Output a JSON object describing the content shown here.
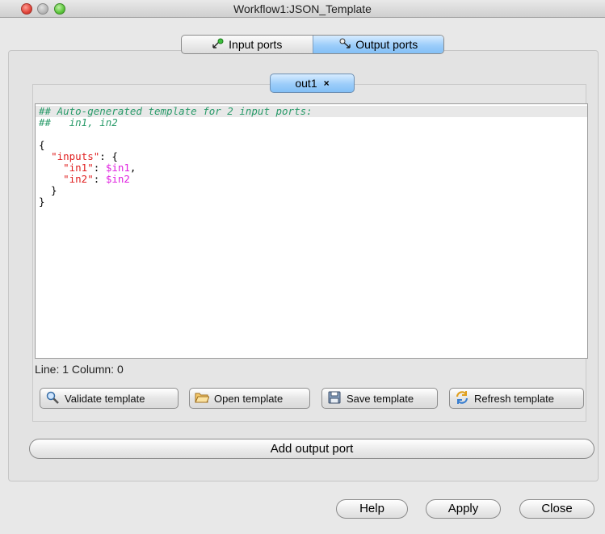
{
  "window": {
    "title": "Workflow1:JSON_Template"
  },
  "top_tabs": [
    {
      "label": "Input ports",
      "selected": false,
      "icon": "input-port-icon"
    },
    {
      "label": "Output ports",
      "selected": true,
      "icon": "output-port-icon"
    }
  ],
  "port_tab": {
    "label": "out1",
    "close": "×"
  },
  "editor": {
    "lines": [
      {
        "parts": [
          {
            "cls": "c-comment",
            "text": "## Auto-generated template for 2 input ports:"
          }
        ],
        "current": true
      },
      {
        "parts": [
          {
            "cls": "c-comment",
            "text": "##   in1, in2"
          }
        ]
      },
      {
        "parts": [
          {
            "cls": "c-txt",
            "text": ""
          }
        ]
      },
      {
        "parts": [
          {
            "cls": "c-txt",
            "text": "{"
          }
        ]
      },
      {
        "parts": [
          {
            "cls": "c-txt",
            "text": "  "
          },
          {
            "cls": "c-str",
            "text": "\"inputs\""
          },
          {
            "cls": "c-txt",
            "text": ": {"
          }
        ]
      },
      {
        "parts": [
          {
            "cls": "c-txt",
            "text": "    "
          },
          {
            "cls": "c-str",
            "text": "\"in1\""
          },
          {
            "cls": "c-txt",
            "text": ": "
          },
          {
            "cls": "c-var",
            "text": "$in1"
          },
          {
            "cls": "c-txt",
            "text": ","
          }
        ]
      },
      {
        "parts": [
          {
            "cls": "c-txt",
            "text": "    "
          },
          {
            "cls": "c-str",
            "text": "\"in2\""
          },
          {
            "cls": "c-txt",
            "text": ": "
          },
          {
            "cls": "c-var",
            "text": "$in2"
          }
        ]
      },
      {
        "parts": [
          {
            "cls": "c-txt",
            "text": "  }"
          }
        ]
      },
      {
        "parts": [
          {
            "cls": "c-txt",
            "text": "}"
          }
        ]
      }
    ]
  },
  "status": {
    "text": "Line: 1 Column: 0"
  },
  "buttons": {
    "validate": "Validate template",
    "open": "Open template",
    "save": "Save template",
    "refresh": "Refresh template",
    "add_output_port": "Add output port",
    "help": "Help",
    "apply": "Apply",
    "close": "Close"
  }
}
